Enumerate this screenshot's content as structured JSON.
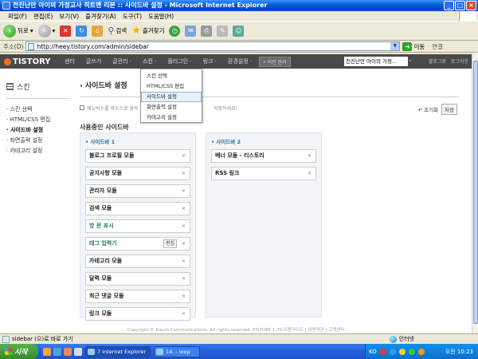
{
  "window": {
    "title": "천진난만 아이의 가정교사 히트맨 리본 :: 사이드바 설정 - Microsoft Internet Explorer"
  },
  "menubar": {
    "items": [
      "파일(F)",
      "편집(E)",
      "보기(V)",
      "즐겨찾기(A)",
      "도구(T)",
      "도움말(H)"
    ]
  },
  "toolbar": {
    "back_label": "뒤로",
    "search_label": "검색",
    "favorites_label": "즐겨찾기"
  },
  "address": {
    "label": "주소(D)",
    "url": "http://heey.tistory.com/admin/sidebar",
    "go_label": "이동",
    "links_label": "연결"
  },
  "tistory_nav": {
    "logo": "TISTORY",
    "items": [
      "센터",
      "글쓰기",
      "글관리 ·",
      "스킨 ·",
      "플러그인 ·",
      "링크 ·",
      "환경설정 ·"
    ],
    "new_button": "• 이전 관리",
    "blog_select": "천진난만 아이의 가정...",
    "blog_link": "블로그로",
    "logout": "로그아웃"
  },
  "dropdown": {
    "items": [
      "스킨 선택",
      "HTML/CSS 편집",
      "사이드바 설정",
      "화면출력 설정",
      "카테고리 설정"
    ],
    "highlighted": "사이드바 설정"
  },
  "left_panel": {
    "title": "스킨",
    "items": [
      "스킨 선택",
      "HTML/CSS 편집",
      "사이드바 설정",
      "화면출력 설정",
      "카테고리 설정"
    ],
    "active": "사이드바 설정"
  },
  "main": {
    "title": "사이드바 설정",
    "notice": "메뉴박스를 마우스로 움직",
    "notice_tail": "저장하세요!",
    "reset_label": "초기화",
    "save_label": "저장",
    "used_title": "사용중인 사이드바",
    "sidebar1": {
      "title": "사이드바 1",
      "modules": [
        "블로그 프로필 모듈",
        "공지사항 모듈",
        "관리자 모듈",
        "검색 모듈",
        "방 문 표시",
        "태그 입력기",
        "카테고리 모듈",
        "달력 모듈",
        "최근 댓글 모듈",
        "링크 모듈"
      ],
      "edit_label": "편집"
    },
    "sidebar2": {
      "title": "사이드바 2",
      "modules": [
        "배너 모듈 - 티스토리",
        "RSS 링크"
      ]
    },
    "remove_symbol": "×"
  },
  "footer": {
    "text": "Copyright © Daum Communications. All rights reserved. TISTORY 1.70   이용가이드  |  이용약관  |  고객센터"
  },
  "statusbar": {
    "text": "sidebar (으)로 바로 가기",
    "zone": "인터넷"
  },
  "taskbar": {
    "start": "시작",
    "tasks": [
      "7 Internet Explorer",
      "14.   - loop"
    ],
    "lang": "KO",
    "clock": "오전 10:23"
  },
  "colors": {
    "tistory_bar": "#494949",
    "tistory_orange": "#f37022",
    "sidebar_heading": "#2a6a9b"
  }
}
